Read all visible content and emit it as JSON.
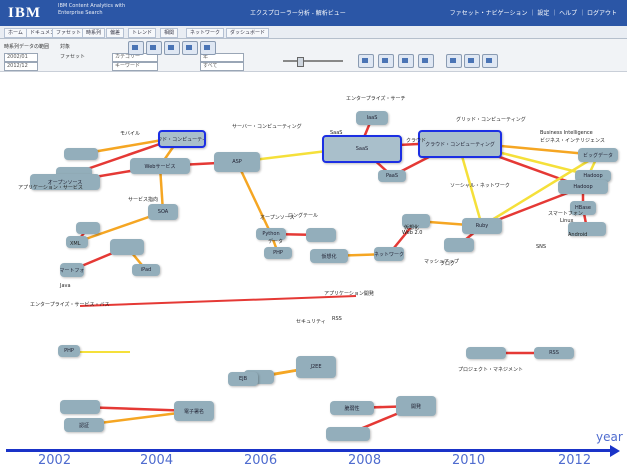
{
  "titlebar": {
    "brand": "IBM",
    "app_line1": "IBM Content Analytics with",
    "app_line2": "Enterprise Search",
    "center": "エクスプローラー分析 - 解析ビュー",
    "right": "ファセット・ナビゲーション ｜ 設定 ｜ ヘルプ ｜ ログアウト"
  },
  "tabs": [
    "ホーム",
    "ドキュメント",
    "ファセット",
    "時系列",
    "偏差",
    "トレンド",
    "相関",
    "ネットワーク",
    "ダッシュボード"
  ],
  "toolbar": {
    "label1": "時系列データの範囲",
    "label2": "対象",
    "label3": "ファセット",
    "sel1": "2002/01",
    "sel2": "2012/12",
    "sel3": "カテゴリー",
    "sel4": "キーワード",
    "sel5": "年",
    "sel6": "すべて"
  },
  "colors": {
    "node": "#93aebb",
    "selected_border": "#1c2fe3",
    "axis": "#1a33c8",
    "year_text": "#4f6ccf"
  },
  "nodes": [
    {
      "id": "n1",
      "text": ""
    },
    {
      "id": "n2",
      "text": "クラウド・コンピューティング"
    },
    {
      "id": "n3",
      "text": ""
    },
    {
      "id": "n4",
      "text": "Webサービス"
    },
    {
      "id": "n5",
      "text": "ASP"
    },
    {
      "id": "n6",
      "text": "SOA"
    },
    {
      "id": "n7",
      "text": "オープンソース"
    },
    {
      "id": "n8",
      "text": ""
    },
    {
      "id": "n9",
      "text": ""
    },
    {
      "id": "n10",
      "text": "SaaS"
    },
    {
      "id": "n11",
      "text": "クラウド・コンピューティング"
    },
    {
      "id": "n12",
      "text": "PaaS"
    },
    {
      "id": "n13",
      "text": "IaaS"
    },
    {
      "id": "n14",
      "text": "ビッグデータ"
    },
    {
      "id": "n15",
      "text": "Hadoop"
    },
    {
      "id": "n16",
      "text": "Hadoop"
    },
    {
      "id": "n17",
      "text": "HBase"
    },
    {
      "id": "n18",
      "text": ""
    },
    {
      "id": "n19",
      "text": "Ruby"
    },
    {
      "id": "n20",
      "text": ""
    },
    {
      "id": "n21",
      "text": "Python"
    },
    {
      "id": "n22",
      "text": "PHP"
    },
    {
      "id": "n23",
      "text": ""
    },
    {
      "id": "n24",
      "text": "仮想化"
    },
    {
      "id": "n25",
      "text": "ネットワーク"
    },
    {
      "id": "n26",
      "text": ""
    },
    {
      "id": "n27",
      "text": "スマートフォン"
    },
    {
      "id": "n28",
      "text": "iPad"
    },
    {
      "id": "n29",
      "text": ""
    },
    {
      "id": "n30",
      "text": ""
    },
    {
      "id": "n31",
      "text": "J2EE"
    },
    {
      "id": "n32",
      "text": "EJB"
    },
    {
      "id": "n33",
      "text": "PHP"
    },
    {
      "id": "n34",
      "text": "開発"
    },
    {
      "id": "n35",
      "text": "脆弱性"
    },
    {
      "id": "n36",
      "text": ""
    },
    {
      "id": "n37",
      "text": "電子署名"
    },
    {
      "id": "n38",
      "text": ""
    },
    {
      "id": "n39",
      "text": "認証"
    },
    {
      "id": "n40",
      "text": ""
    },
    {
      "id": "n41",
      "text": "RSS"
    }
  ],
  "labels": [
    "サーバー・コンピューティング",
    "エンタープライズ・サーチ",
    "ビジネス・インテリジェンス",
    "Business Intelligence",
    "SaaS",
    "グリッド・コンピューティング",
    "ソーシャル・ネットワーク",
    "アプリケーション・サービス",
    "モバイル",
    "スマートフォン",
    "Android",
    "Linux",
    "データ",
    "ロングテール",
    "サービス指向",
    "オープンソース",
    "エンタープライズ・サービス・バス",
    "アプリケーション開発",
    "XML",
    "Web 2.0",
    "マッシュアップ",
    "RSS",
    "ブログ",
    "SNS",
    "Java",
    "クラウド",
    "仮想化",
    "セキュリティ",
    "プロジェクト・マネジメント"
  ],
  "timeline": {
    "years": [
      "2002",
      "2004",
      "2006",
      "2008",
      "2010",
      "2012"
    ],
    "axis_label": "year"
  }
}
